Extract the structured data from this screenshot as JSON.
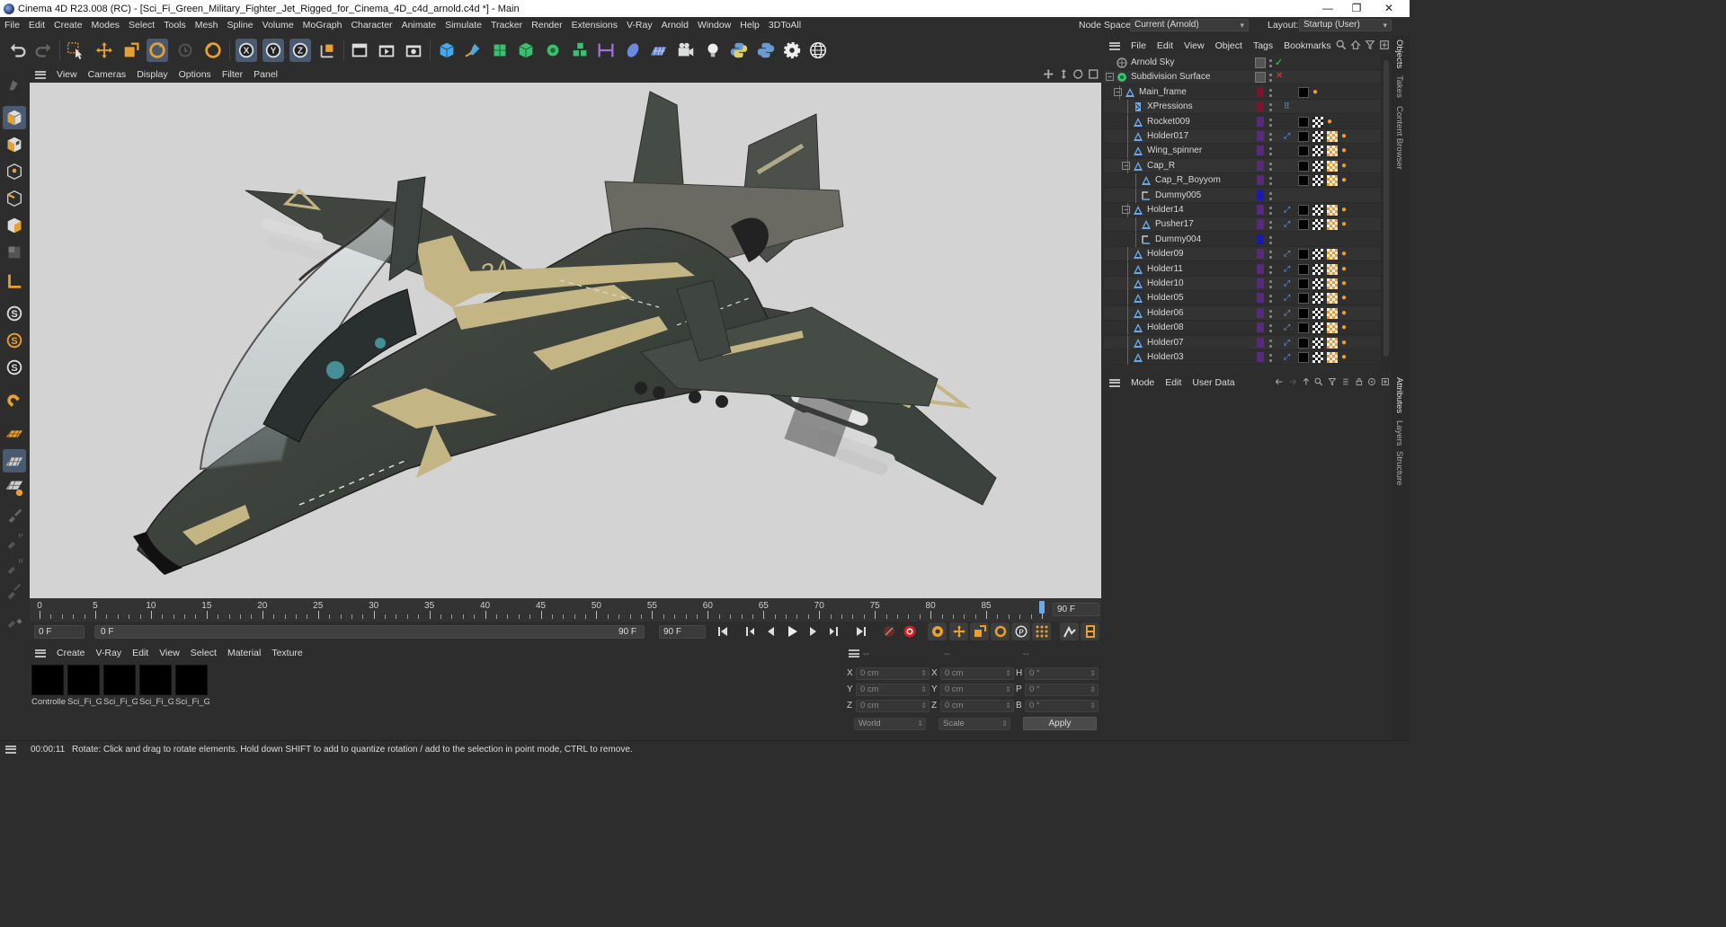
{
  "window": {
    "title": "Cinema 4D R23.008 (RC) - [Sci_Fi_Green_Military_Fighter_Jet_Rigged_for_Cinema_4D_c4d_arnold.c4d *] - Main",
    "minimize": "—",
    "maximize": "❐",
    "close": "✕"
  },
  "menu": [
    "File",
    "Edit",
    "Create",
    "Modes",
    "Select",
    "Tools",
    "Mesh",
    "Spline",
    "Volume",
    "MoGraph",
    "Character",
    "Animate",
    "Simulate",
    "Tracker",
    "Render",
    "Extensions",
    "V-Ray",
    "Arnold",
    "Window",
    "Help",
    "3DToAll"
  ],
  "node_space": {
    "label": "Node Space:",
    "value": "Current (Arnold)"
  },
  "layout": {
    "label": "Layout:",
    "value": "Startup (User)"
  },
  "viewport_menu": [
    "View",
    "Cameras",
    "Display",
    "Options",
    "Filter",
    "Panel"
  ],
  "timeline": {
    "labels": [
      "0",
      "5",
      "10",
      "15",
      "20",
      "25",
      "30",
      "35",
      "40",
      "45",
      "50",
      "55",
      "60",
      "65",
      "70",
      "75",
      "80",
      "85"
    ],
    "end_field": "90 F",
    "playhead_frame": 90
  },
  "transport": {
    "current_frame": "0 F",
    "range_start": "0 F",
    "range_end": "90 F",
    "max_frame": "90 F"
  },
  "material_menu": [
    "Create",
    "V-Ray",
    "Edit",
    "View",
    "Select",
    "Material",
    "Texture"
  ],
  "materials": [
    "Controlle",
    "Sci_Fi_Gr",
    "Sci_Fi_Gr",
    "Sci_Fi_Gr",
    "Sci_Fi_Gr"
  ],
  "coordinates": {
    "header1": "--",
    "header2": "--",
    "header3": "--",
    "rows": [
      {
        "a": "X",
        "av": "0 cm",
        "b": "X",
        "bv": "0 cm",
        "c": "H",
        "cv": "0 °"
      },
      {
        "a": "Y",
        "av": "0 cm",
        "b": "Y",
        "bv": "0 cm",
        "c": "P",
        "cv": "0 °"
      },
      {
        "a": "Z",
        "av": "0 cm",
        "b": "Z",
        "bv": "0 cm",
        "c": "B",
        "cv": "0 °"
      }
    ],
    "space": "World",
    "mode": "Scale",
    "apply": "Apply"
  },
  "status": {
    "time": "00:00:11",
    "message": "Rotate: Click and drag to rotate elements. Hold down SHIFT to add to quantize rotation / add to the selection in point mode, CTRL to remove."
  },
  "object_menu": [
    "File",
    "Edit",
    "View",
    "Object",
    "Tags",
    "Bookmarks"
  ],
  "objects": [
    {
      "name": "Arnold Sky",
      "indent": 0,
      "icon": "sky",
      "color": "",
      "status": "check"
    },
    {
      "name": "Subdivision Surface",
      "indent": 0,
      "icon": "subdiv",
      "color": "",
      "status": "cross"
    },
    {
      "name": "Main_frame",
      "indent": 1,
      "icon": "joint",
      "color": "#7a1530",
      "status": ""
    },
    {
      "name": "XPressions",
      "indent": 2,
      "icon": "xpresso",
      "color": "#7a1530",
      "status": ""
    },
    {
      "name": "Rocket009",
      "indent": 2,
      "icon": "joint",
      "color": "#5a2a7a",
      "status": ""
    },
    {
      "name": "Holder017",
      "indent": 2,
      "icon": "joint",
      "color": "#5a2a7a",
      "status": ""
    },
    {
      "name": "Wing_spinner",
      "indent": 2,
      "icon": "joint",
      "color": "#5a2a7a",
      "status": ""
    },
    {
      "name": "Cap_R",
      "indent": 2,
      "icon": "joint",
      "color": "#5a2a7a",
      "status": ""
    },
    {
      "name": "Cap_R_Boyyom",
      "indent": 3,
      "icon": "joint",
      "color": "#5a2a7a",
      "status": ""
    },
    {
      "name": "Dummy005",
      "indent": 3,
      "icon": "null",
      "color": "#1a1ab0",
      "status": ""
    },
    {
      "name": "Holder14",
      "indent": 2,
      "icon": "joint",
      "color": "#5a2a7a",
      "status": ""
    },
    {
      "name": "Pusher17",
      "indent": 3,
      "icon": "joint",
      "color": "#5a2a7a",
      "status": ""
    },
    {
      "name": "Dummy004",
      "indent": 3,
      "icon": "null",
      "color": "#1a1ab0",
      "status": ""
    },
    {
      "name": "Holder09",
      "indent": 2,
      "icon": "joint",
      "color": "#5a2a7a",
      "status": ""
    },
    {
      "name": "Holder11",
      "indent": 2,
      "icon": "joint",
      "color": "#5a2a7a",
      "status": ""
    },
    {
      "name": "Holder10",
      "indent": 2,
      "icon": "joint",
      "color": "#5a2a7a",
      "status": ""
    },
    {
      "name": "Holder05",
      "indent": 2,
      "icon": "joint",
      "color": "#5a2a7a",
      "status": ""
    },
    {
      "name": "Holder06",
      "indent": 2,
      "icon": "joint",
      "color": "#5a2a7a",
      "status": ""
    },
    {
      "name": "Holder08",
      "indent": 2,
      "icon": "joint",
      "color": "#5a2a7a",
      "status": ""
    },
    {
      "name": "Holder07",
      "indent": 2,
      "icon": "joint",
      "color": "#5a2a7a",
      "status": ""
    },
    {
      "name": "Holder03",
      "indent": 2,
      "icon": "joint",
      "color": "#5a2a7a",
      "status": ""
    }
  ],
  "attribute_menu": [
    "Mode",
    "Edit",
    "User Data"
  ],
  "side_tabs_top": [
    "Objects",
    "Takes",
    "Content Browser"
  ],
  "side_tabs_bottom": [
    "Attributes",
    "Layers",
    "Structure"
  ],
  "jet": {
    "number": "34"
  }
}
